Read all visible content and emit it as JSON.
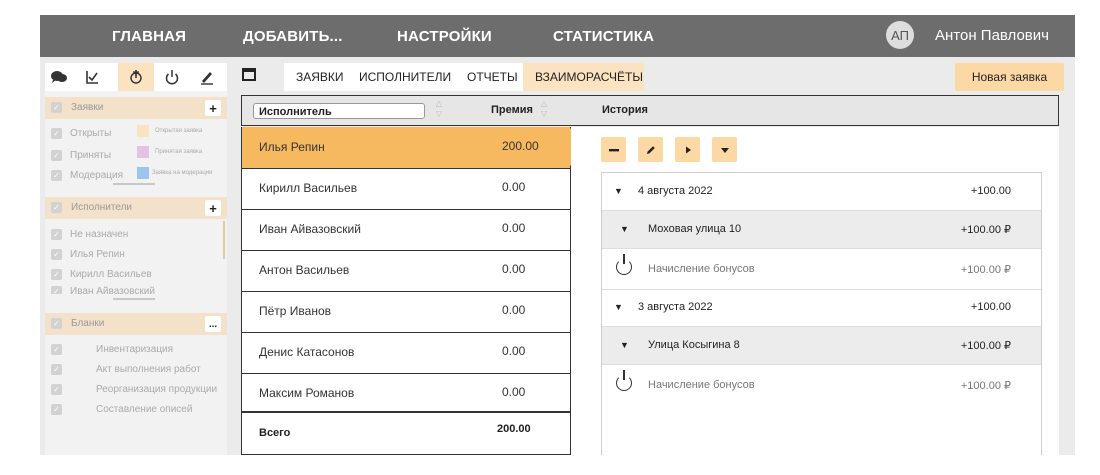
{
  "nav": {
    "home": "ГЛАВНАЯ",
    "add": "ДОБАВИТЬ...",
    "settings": "НАСТРОЙКИ",
    "stats": "СТАТИСТИКА",
    "avatar_initials": "АП",
    "user_name": "Антон Павлович"
  },
  "sidebar": {
    "requests": {
      "title": "Заявки",
      "items": [
        "Открыты",
        "Приняты",
        "Модерация"
      ],
      "legend": [
        {
          "label": "Открытая заявка",
          "color": "#fbe3c1"
        },
        {
          "label": "Принятая заявка",
          "color": "#e2c3e6"
        },
        {
          "label": "Заявка на модерации",
          "color": "#9cc4ef"
        }
      ]
    },
    "performers": {
      "title": "Исполнители",
      "items": [
        "Не назначен",
        "Илья Репин",
        "Кирилл Васильев",
        "Иван Айвазовский"
      ]
    },
    "forms": {
      "title": "Бланки",
      "more": "...",
      "items": [
        "Инвентаризация",
        "Акт выполнения работ",
        "Реорганизация продукции",
        "Составление описей"
      ]
    }
  },
  "tabs": {
    "items": [
      "ЗАЯВКИ",
      "ИСПОЛНИТЕЛИ",
      "ОТЧЕТЫ",
      "ВЗАИМОРАСЧЁТЫ"
    ],
    "active": "ВЗАИМОРАСЧЁТЫ",
    "new_request": "Новая заявка"
  },
  "table_header": {
    "performer": "Исполнитель",
    "bonus": "Премия",
    "history": "История"
  },
  "performers": [
    {
      "name": "Илья Репин",
      "bonus": "200.00",
      "selected": true
    },
    {
      "name": "Кирилл Васильев",
      "bonus": "0.00"
    },
    {
      "name": "Иван Айвазовский",
      "bonus": "0.00"
    },
    {
      "name": "Антон Васильев",
      "bonus": "0.00"
    },
    {
      "name": "Пётр Иванов",
      "bonus": "0.00"
    },
    {
      "name": "Денис Катасонов",
      "bonus": "0.00"
    },
    {
      "name": "Максим Романов",
      "bonus": "0.00"
    }
  ],
  "total": {
    "label": "Всего",
    "value": "200.00"
  },
  "history": [
    {
      "kind": "date",
      "label": "4 августа 2022",
      "amount": "+100.00"
    },
    {
      "kind": "address",
      "label": "Моховая улица 10",
      "amount": "+100.00 ₽"
    },
    {
      "kind": "entry",
      "label": "Начисление бонусов",
      "amount": "+100.00 ₽"
    },
    {
      "kind": "date",
      "label": "3 августа 2022",
      "amount": "+100.00"
    },
    {
      "kind": "address",
      "label": "Улица Косыгина 8",
      "amount": "+100.00 ₽"
    },
    {
      "kind": "entry",
      "label": "Начисление бонусов",
      "amount": "+100.00 ₽"
    }
  ]
}
